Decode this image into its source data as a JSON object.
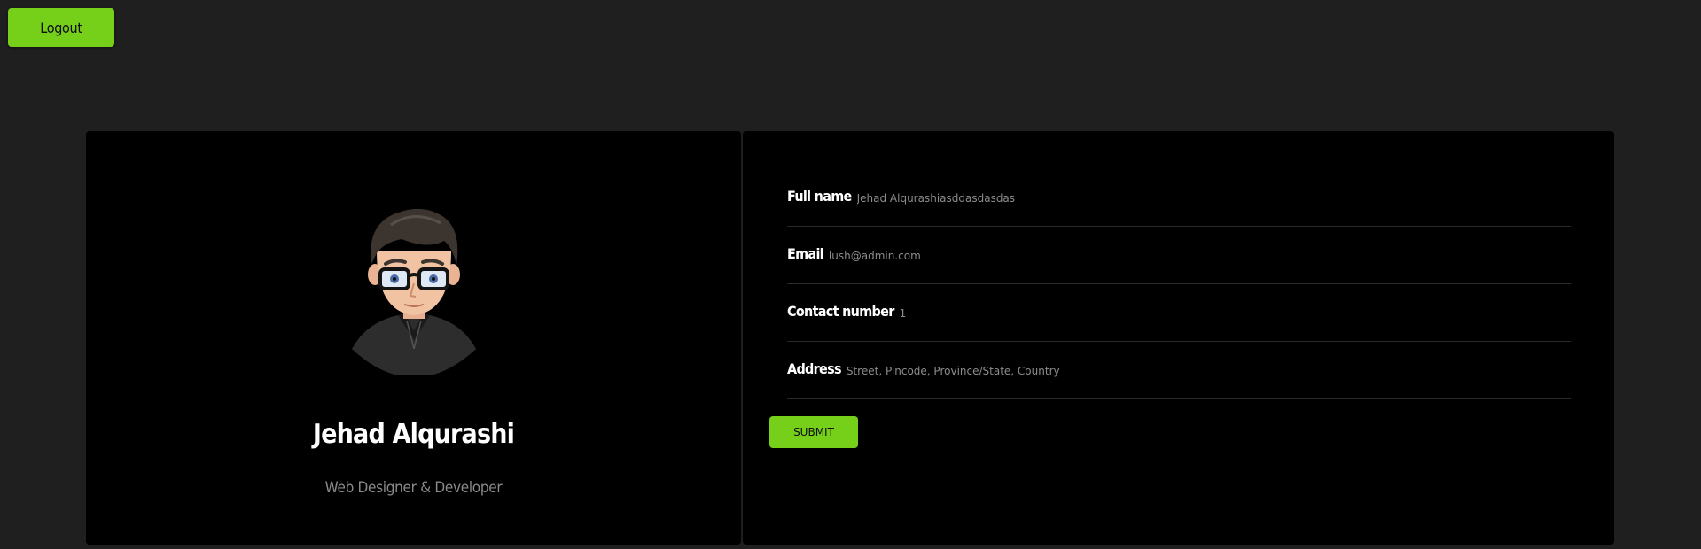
{
  "header": {
    "logout_label": "Logout"
  },
  "profile": {
    "name": "Jehad Alqurashi",
    "role": "Web Designer & Developer"
  },
  "form": {
    "fields": [
      {
        "label": "Full name",
        "value": "Jehad Alqurashiasddasdasdas",
        "placeholder": ""
      },
      {
        "label": "Email",
        "value": "lush@admin.com",
        "placeholder": ""
      },
      {
        "label": "Contact number",
        "value": "1",
        "placeholder": ""
      },
      {
        "label": "Address",
        "value": "",
        "placeholder": "Street, Pincode, Province/State, Country"
      }
    ],
    "submit_label": "SUBMIT"
  },
  "colors": {
    "background": "#1f1f1f",
    "card": "#000000",
    "accent": "#76d01a",
    "muted_text": "#8c8c8c"
  },
  "icons": {
    "avatar": "cartoon-avatar-man-with-glasses"
  }
}
